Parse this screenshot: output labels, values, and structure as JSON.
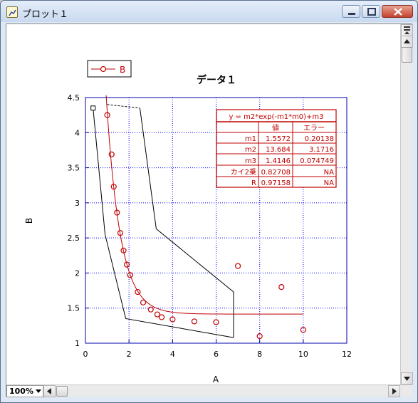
{
  "window": {
    "title": "プロット１"
  },
  "plot": {
    "title": "データ１",
    "xlabel": "A",
    "ylabel": "B",
    "legend": "B",
    "xticks": [
      "0",
      "2",
      "4",
      "6",
      "8",
      "10",
      "12"
    ],
    "yticks": [
      "1",
      "1.5",
      "2",
      "2.5",
      "3",
      "3.5",
      "4",
      "4.5"
    ]
  },
  "fit_table": {
    "equation": "y = m2*exp(-m1*m0)+m3",
    "header": [
      "",
      "値",
      "エラー"
    ],
    "rows": [
      [
        "m1",
        "1.5572",
        "0.20138"
      ],
      [
        "m2",
        "13.684",
        "3.1716"
      ],
      [
        "m3",
        "1.4146",
        "0.074749"
      ],
      [
        "カイ2乗",
        "0.82708",
        "NA"
      ],
      [
        "R",
        "0.97158",
        "NA"
      ]
    ]
  },
  "statusbar": {
    "zoom": "100%"
  },
  "colors": {
    "axis": "#0000a8",
    "series": "#c00000",
    "grid": "#0000ff"
  },
  "chart_data": {
    "type": "scatter",
    "title": "データ１",
    "xlabel": "A",
    "ylabel": "B",
    "xlim": [
      0,
      12
    ],
    "ylim": [
      1,
      4.5
    ],
    "grid": true,
    "legend_position": "top-left",
    "series": [
      {
        "name": "B",
        "points": [
          [
            1.0,
            4.25
          ],
          [
            1.2,
            3.69
          ],
          [
            1.3,
            3.23
          ],
          [
            1.45,
            2.86
          ],
          [
            1.6,
            2.57
          ],
          [
            1.75,
            2.32
          ],
          [
            1.9,
            2.12
          ],
          [
            2.05,
            1.97
          ],
          [
            2.4,
            1.73
          ],
          [
            2.65,
            1.58
          ],
          [
            3.0,
            1.48
          ],
          [
            3.3,
            1.41
          ],
          [
            3.5,
            1.37
          ],
          [
            4.0,
            1.34
          ],
          [
            5.0,
            1.31
          ],
          [
            6.0,
            1.3
          ],
          [
            7.0,
            2.1
          ],
          [
            8.0,
            1.1
          ],
          [
            9.0,
            1.8
          ],
          [
            10.0,
            1.19
          ]
        ]
      }
    ],
    "fit": {
      "m1": 1.5572,
      "m2": 13.684,
      "m3": 1.4146,
      "x_range": [
        0.95,
        10.0
      ]
    },
    "bands": {
      "lower": [
        [
          0.35,
          4.35
        ],
        [
          0.9,
          2.55
        ],
        [
          1.85,
          1.35
        ],
        [
          6.8,
          1.08
        ]
      ],
      "upper": [
        [
          2.5,
          4.35
        ],
        [
          3.25,
          2.63
        ],
        [
          6.8,
          1.73
        ],
        [
          6.8,
          1.08
        ]
      ],
      "dashed_top": [
        [
          1.0,
          4.4
        ],
        [
          2.5,
          4.35
        ]
      ],
      "anchor_point": [
        0.35,
        4.35
      ]
    }
  }
}
